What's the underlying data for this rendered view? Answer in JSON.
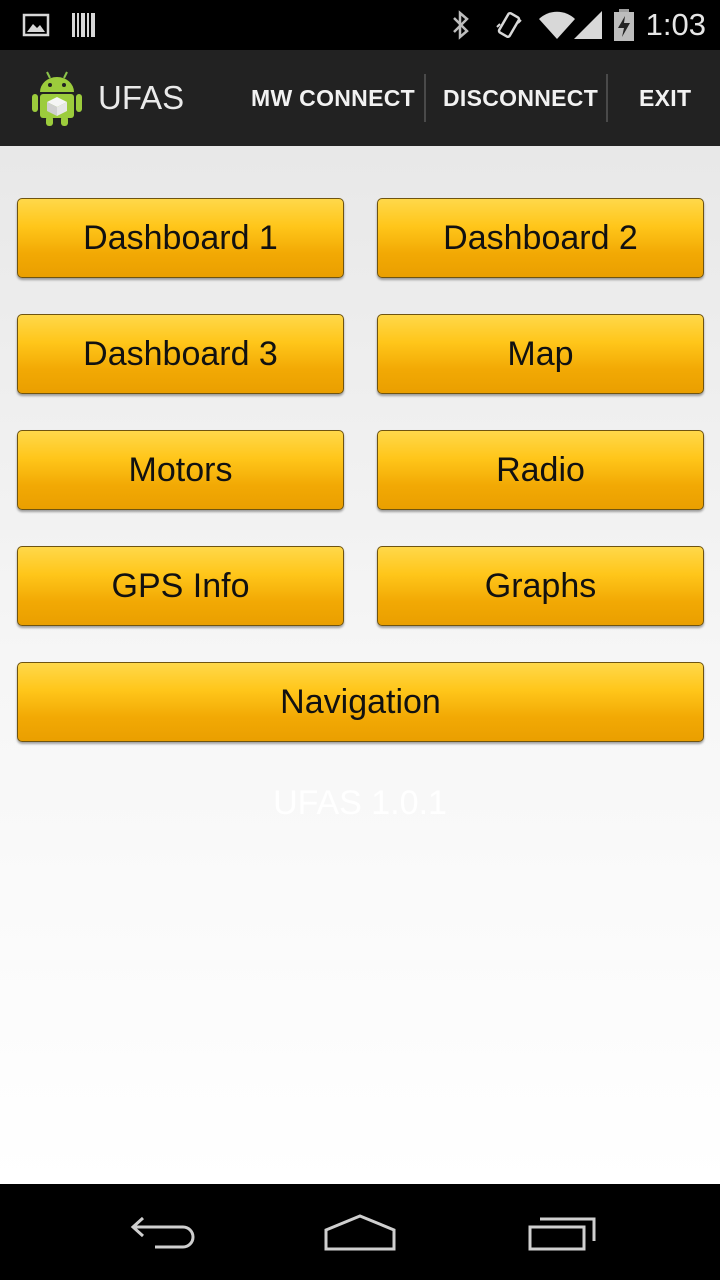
{
  "status_bar": {
    "time": "1:03",
    "left_icons": [
      "image-notification-icon",
      "barcode-notification-icon"
    ],
    "right_icons": [
      "bluetooth-icon",
      "vibrate-icon",
      "wifi-icon",
      "signal-icon",
      "battery-icon"
    ]
  },
  "action_bar": {
    "app_title": "UFAS",
    "app_icon": "android-robot-icon",
    "actions": {
      "mw_connect": "MW CONNECT",
      "disconnect": "DISCONNECT",
      "exit": "EXIT"
    }
  },
  "main": {
    "buttons": {
      "dashboard1": "Dashboard 1",
      "dashboard2": "Dashboard 2",
      "dashboard3": "Dashboard 3",
      "map": "Map",
      "motors": "Motors",
      "radio": "Radio",
      "gps_info": "GPS Info",
      "graphs": "Graphs",
      "navigation": "Navigation"
    },
    "version": "UFAS 1.0.1"
  },
  "nav_bar": {
    "icons": [
      "back-icon",
      "home-icon",
      "recent-apps-icon"
    ]
  },
  "colors": {
    "button_gradient_top": "#ffd84a",
    "button_gradient_bottom": "#ea9f00",
    "action_bar": "#222222"
  }
}
